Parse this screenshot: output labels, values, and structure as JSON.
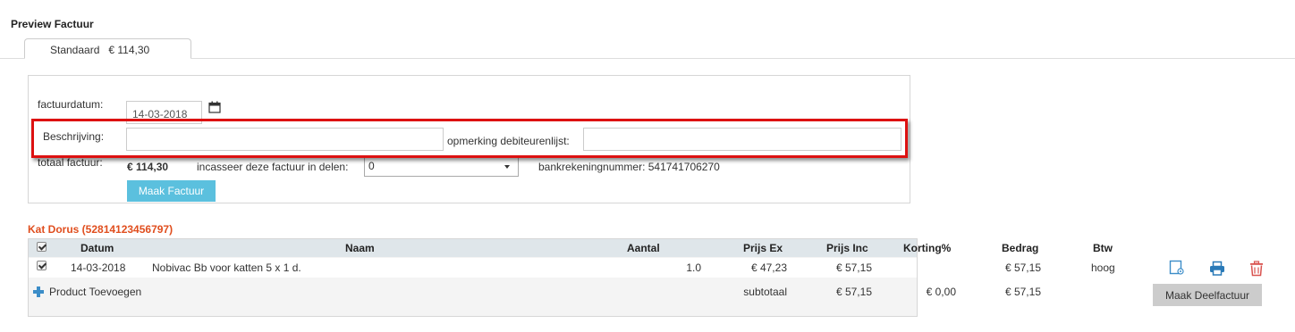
{
  "page_title": "Preview Factuur",
  "tabs": [
    {
      "label": "Standaard",
      "amount": "€ 114,30"
    }
  ],
  "form": {
    "factuurdatum_label": "factuurdatum:",
    "factuurdatum_value": "14-03-2018",
    "beschrijving_label": "Beschrijving:",
    "beschrijving_value": "",
    "opmerking_label": "opmerking debiteurenlijst:",
    "opmerking_value": "",
    "totaal_label": "totaal factuur:",
    "totaal_value": "€ 114,30",
    "incasseer_label": "incasseer deze factuur in delen:",
    "incasseer_value": "0",
    "bankrekening_text": "bankrekeningnummer: 541741706270",
    "submit_label": "Maak Factuur"
  },
  "client_title": "Kat Dorus (52814123456797)",
  "table": {
    "headers": {
      "datum": "Datum",
      "naam": "Naam",
      "aantal": "Aantal",
      "prijs_ex": "Prijs Ex",
      "prijs_inc": "Prijs Inc",
      "korting": "Korting%",
      "bedrag": "Bedrag",
      "btw": "Btw"
    },
    "rows": [
      {
        "checked": true,
        "datum": "14-03-2018",
        "naam": "Nobivac Bb voor katten 5 x 1 d.",
        "aantal": "1.0",
        "prijs_ex": "€ 47,23",
        "prijs_inc": "€ 57,15",
        "korting": "",
        "bedrag": "€ 57,15",
        "btw": "hoog"
      }
    ],
    "footer": {
      "add_product_label": "Product Toevoegen",
      "subtotaal_label": "subtotaal",
      "subtotaal_inc": "€ 57,15",
      "subtotaal_korting": "€ 0,00",
      "subtotaal_bedrag": "€ 57,15",
      "deelfactuur_label": "Maak Deelfactuur"
    }
  },
  "colors": {
    "accent": "#5bc0de",
    "client_title": "#e04e1e",
    "highlight": "#dd1111",
    "icon_blue": "#3c8dc8",
    "delete_red": "#d9534f"
  },
  "icons": [
    "calendar-icon",
    "preview-icon",
    "print-icon",
    "trash-icon",
    "plus-icon",
    "checkbox"
  ]
}
